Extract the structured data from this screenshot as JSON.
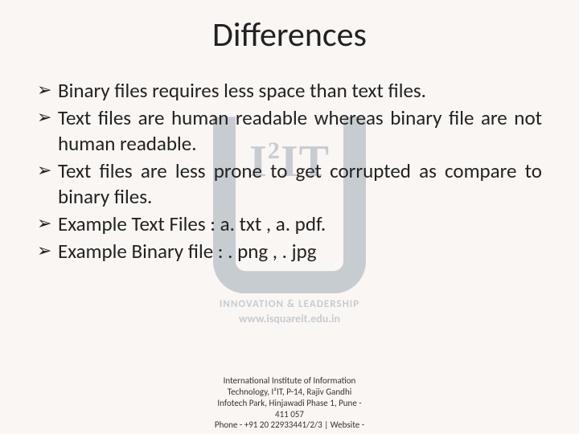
{
  "title": "Differences",
  "bullets": [
    "Binary files requires less space than text files.",
    "Text files are human readable whereas binary file are not human readable.",
    "Text files are less prone to get corrupted as compare to binary files.",
    " Example  Text Files : a. txt , a. pdf.",
    "Example Binary file : . png , . jpg"
  ],
  "watermark": {
    "logo_text": "I²IT",
    "tagline": "INNOVATION & LEADERSHIP",
    "url": "www.isquareit.edu.in"
  },
  "footer": {
    "line1": "International Institute of Information",
    "line2": "Technology, I²IT, P-14, Rajiv Gandhi",
    "line3": "Infotech Park, Hinjawadi Phase 1, Pune -",
    "line4": "411 057",
    "line5": "Phone - +91 20 22933441/2/3 | Website -"
  }
}
